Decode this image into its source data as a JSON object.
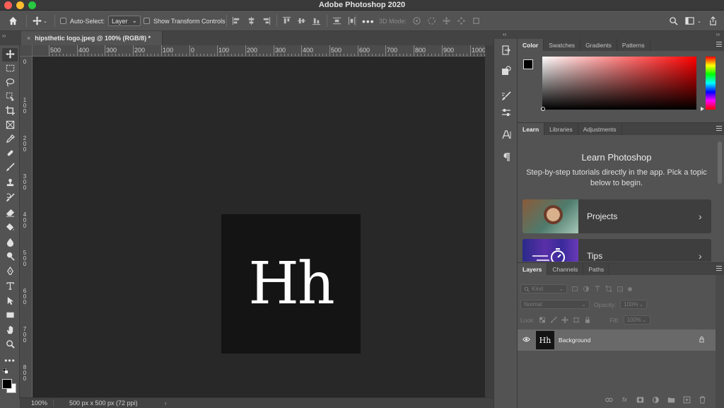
{
  "window": {
    "title": "Adobe Photoshop 2020"
  },
  "options_bar": {
    "auto_select_label": "Auto-Select:",
    "auto_select_target": "Layer",
    "show_transform_controls_label": "Show Transform Controls",
    "mode_3d_label": "3D Mode:"
  },
  "document": {
    "tab_label": "hipsthetic logo.jpeg @ 100% (RGB/8) *",
    "close_glyph": "×",
    "image_text": "Hh"
  },
  "rulers": {
    "top_labels": [
      "500",
      "400",
      "300",
      "200",
      "100",
      "0",
      "100",
      "200",
      "300",
      "400",
      "500",
      "600",
      "700",
      "800",
      "900",
      "1000"
    ],
    "left_labels": [
      "0",
      "100",
      "200",
      "300",
      "400",
      "500",
      "600",
      "700",
      "800"
    ]
  },
  "status_bar": {
    "zoom": "100%",
    "doc_info": "500 px x 500 px (72 ppi)",
    "chevron": "›"
  },
  "color_panel": {
    "tabs": [
      "Color",
      "Swatches",
      "Gradients",
      "Patterns"
    ],
    "active_tab": "Color",
    "foreground": "#000000",
    "background": "#ffffff",
    "hue_color": "#ff0000"
  },
  "learn_panel": {
    "tabs": [
      "Learn",
      "Libraries",
      "Adjustments"
    ],
    "active_tab": "Learn",
    "title": "Learn Photoshop",
    "description": "Step-by-step tutorials directly in the app. Pick a topic below to begin.",
    "cards": [
      {
        "label": "Projects"
      },
      {
        "label": "Tips"
      }
    ]
  },
  "layers_panel": {
    "tabs": [
      "Layers",
      "Channels",
      "Paths"
    ],
    "active_tab": "Layers",
    "filter_label": "Kind",
    "blend_mode": "Normal",
    "opacity_label": "Opacity:",
    "opacity_value": "100%",
    "lock_label": "Lock:",
    "fill_label": "Fill:",
    "fill_value": "100%",
    "layers": [
      {
        "name": "Background",
        "thumb_text": "Hh",
        "visible": true,
        "locked": true
      }
    ]
  }
}
